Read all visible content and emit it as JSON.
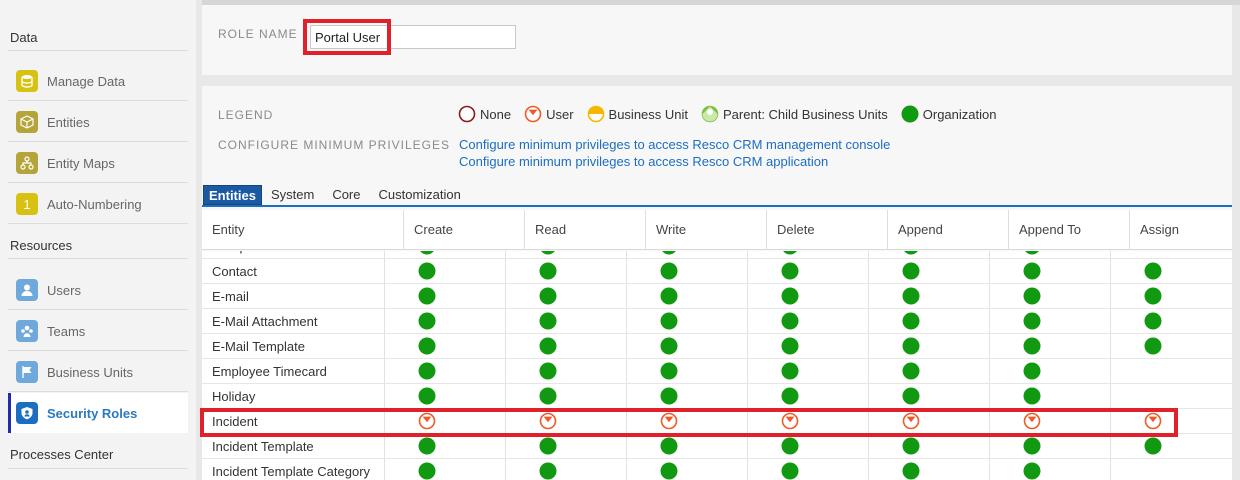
{
  "sidebar": {
    "sections": [
      {
        "title": "Data",
        "items": [
          {
            "label": "Manage Data",
            "icon": "database-icon",
            "color": "#d7c213"
          },
          {
            "label": "Entities",
            "icon": "cube-icon",
            "color": "#b5a43a"
          },
          {
            "label": "Entity Maps",
            "icon": "hierarchy-icon",
            "color": "#b5a43a"
          },
          {
            "label": "Auto-Numbering",
            "icon": "number-one-icon",
            "color": "#d7c213"
          }
        ]
      },
      {
        "title": "Resources",
        "items": [
          {
            "label": "Users",
            "icon": "user-icon",
            "color": "#6fa9dc"
          },
          {
            "label": "Teams",
            "icon": "team-icon",
            "color": "#6fa9dc"
          },
          {
            "label": "Business Units",
            "icon": "flag-icon",
            "color": "#6fa9dc"
          },
          {
            "label": "Security Roles",
            "icon": "shield-user-icon",
            "color": "#1c6fc0",
            "active": true
          }
        ]
      },
      {
        "title": "Processes Center",
        "items": []
      }
    ],
    "number_glyph": "1"
  },
  "role": {
    "label": "ROLE NAME",
    "value": "Portal User"
  },
  "legend": {
    "label": "LEGEND",
    "items": [
      {
        "label": "None",
        "level": "none"
      },
      {
        "label": "User",
        "level": "user"
      },
      {
        "label": "Business Unit",
        "level": "bu"
      },
      {
        "label": "Parent: Child Business Units",
        "level": "parent"
      },
      {
        "label": "Organization",
        "level": "org"
      }
    ]
  },
  "min_priv": {
    "label": "CONFIGURE MINIMUM PRIVILEGES",
    "links": [
      "Configure minimum privileges to access Resco CRM management console",
      "Configure minimum privileges to access Resco CRM application"
    ]
  },
  "tabs": [
    "Entities",
    "System",
    "Core",
    "Customization"
  ],
  "active_tab": "Entities",
  "columns": [
    "Entity",
    "Create",
    "Read",
    "Write",
    "Delete",
    "Append",
    "Append To",
    "Assign"
  ],
  "rows": [
    {
      "entity": "Competitor",
      "privs": [
        "org",
        "org",
        "org",
        "org",
        "org",
        "org",
        ""
      ],
      "partial": true
    },
    {
      "entity": "Contact",
      "privs": [
        "org",
        "org",
        "org",
        "org",
        "org",
        "org",
        "org"
      ]
    },
    {
      "entity": "E-mail",
      "privs": [
        "org",
        "org",
        "org",
        "org",
        "org",
        "org",
        "org"
      ]
    },
    {
      "entity": "E-Mail Attachment",
      "privs": [
        "org",
        "org",
        "org",
        "org",
        "org",
        "org",
        "org"
      ]
    },
    {
      "entity": "E-Mail Template",
      "privs": [
        "org",
        "org",
        "org",
        "org",
        "org",
        "org",
        "org"
      ]
    },
    {
      "entity": "Employee Timecard",
      "privs": [
        "org",
        "org",
        "org",
        "org",
        "org",
        "org",
        ""
      ]
    },
    {
      "entity": "Holiday",
      "privs": [
        "org",
        "org",
        "org",
        "org",
        "org",
        "org",
        ""
      ]
    },
    {
      "entity": "Incident",
      "privs": [
        "user",
        "user",
        "user",
        "user",
        "user",
        "user",
        "user"
      ],
      "highlighted": true
    },
    {
      "entity": "Incident Template",
      "privs": [
        "org",
        "org",
        "org",
        "org",
        "org",
        "org",
        "org"
      ]
    },
    {
      "entity": "Incident Template Category",
      "privs": [
        "org",
        "org",
        "org",
        "org",
        "org",
        "org",
        ""
      ]
    }
  ],
  "colors": {
    "org": "#119a11",
    "user_ring": "#f05a28",
    "bu": "#f5b800",
    "parent": "#7cc144",
    "none_ring": "#8b1a1a",
    "highlight": "#e0202a",
    "link": "#1b6ec2",
    "active_tab": "#1b5aa3"
  }
}
